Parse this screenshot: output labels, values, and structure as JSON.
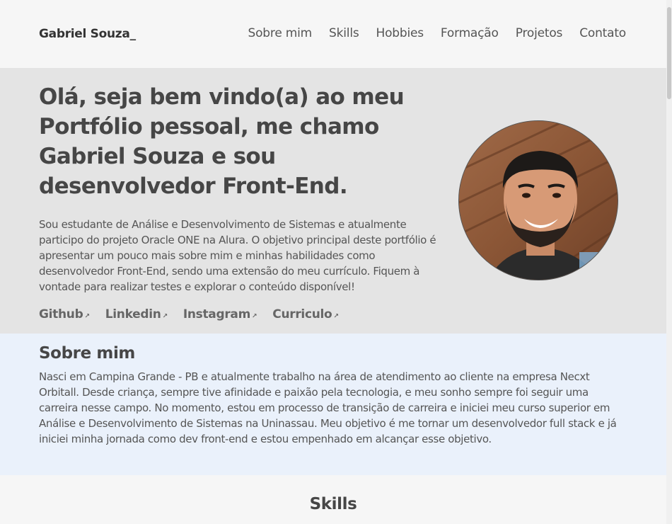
{
  "header": {
    "logo": "Gabriel Souza_",
    "nav": [
      "Sobre mim",
      "Skills",
      "Hobbies",
      "Formação",
      "Projetos",
      "Contato"
    ]
  },
  "hero": {
    "title": "Olá, seja bem vindo(a) ao meu Portfólio pessoal, me chamo Gabriel Souza e sou desenvolvedor Front-End.",
    "description": "Sou estudante de Análise e Desenvolvimento de Sistemas e atualmente participo do projeto Oracle ONE na Alura. O objetivo principal deste portfólio é apresentar um pouco mais sobre mim e minhas habilidades como desenvolvedor Front-End, sendo uma extensão do meu currículo. Fiquem à vontade para realizar testes e explorar o conteúdo disponível!",
    "links": [
      "Github",
      "Linkedin",
      "Instagram",
      "Curriculo"
    ],
    "link_arrow": "↗"
  },
  "about": {
    "title": "Sobre mim",
    "text": "Nasci em Campina Grande - PB e atualmente trabalho na área de atendimento ao cliente na empresa Necxt Orbitall. Desde criança, sempre tive afinidade e paixão pela tecnologia, e meu sonho sempre foi seguir uma carreira nesse campo. No momento, estou em processo de transição de carreira e iniciei meu curso superior em Análise e Desenvolvimento de Sistemas na Uninassau. Meu objetivo é me tornar um desenvolvedor full stack e já iniciei minha jornada como dev front-end e estou empenhado em alcançar esse objetivo."
  },
  "skills": {
    "title": "Skills"
  },
  "colors": {
    "header_bg": "#f6f6f6",
    "hero_bg": "#e4e4e4",
    "about_bg": "#eaf1fb",
    "text": "#464646"
  }
}
